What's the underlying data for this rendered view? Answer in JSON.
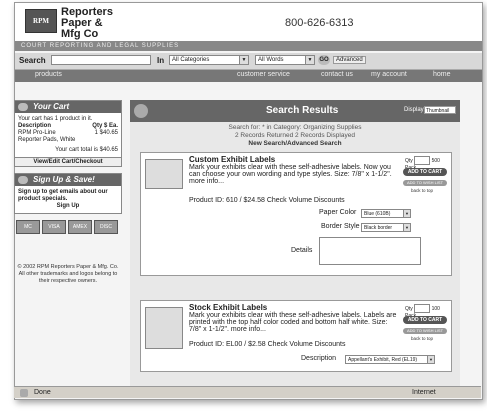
{
  "header": {
    "logo": "RPM",
    "brand_line1": "Reporters",
    "brand_line2": "Paper &",
    "brand_line3": "Mfg Co",
    "phone": "800-626-6313",
    "tagline": "COURT REPORTING AND LEGAL SUPPLIES"
  },
  "search": {
    "label": "Search",
    "in_label": "In",
    "category": "All Categories",
    "words": "All Words",
    "go": "GO",
    "advanced": "Advanced"
  },
  "nav": {
    "products": "products",
    "customer_service": "customer service",
    "contact_us": "contact us",
    "my_account": "my account",
    "home": "home"
  },
  "cart": {
    "title": "Your Cart",
    "summary": "Your cart has 1 product in it.",
    "col_desc": "Description",
    "col_qty": "Qty",
    "col_ea": "$ Ea.",
    "item": "RPM Pro-Line Reporter Pads, White",
    "item_qty": "1",
    "item_price": "$40.65",
    "total": "Your cart total is $40.65",
    "view_edit": "View/Edit Cart/Checkout"
  },
  "signup": {
    "title": "Sign Up & Save!",
    "text": "Sign up to get emails about our product specials.",
    "link": "Sign Up"
  },
  "cards": [
    "MC",
    "VISA",
    "AMEX",
    "DISC"
  ],
  "copyright": "© 2002 RPM Reporters Paper & Mfg. Co. All other trademarks and logos belong to their respective owners.",
  "results": {
    "title": "Search Results",
    "display_label": "Display:",
    "display_value": "Thumbnail",
    "line1": "Search for: * in Category: Organizing Supplies",
    "line2": "2 Records Returned 2 Records Displayed",
    "line3": "New Search/Advanced Search"
  },
  "products": [
    {
      "title": "Custom Exhibit Labels",
      "desc": "Mark your exhibits clear with these self-adhesive labels. Now you can choose your own wording and type styles. Size: 7/8\" x 1-1/2\". more info...",
      "pid": "Product ID: 610 / $24.58",
      "volume": "Check Volume Discounts",
      "qty_label": "Qty",
      "qty_unit": "500 Pack",
      "add_btn": "ADD TO CART",
      "wish_btn": "ADD TO WISH LIST",
      "back": "back to top",
      "opt1_label": "Paper Color",
      "opt1_value": "Blue (610B)",
      "opt2_label": "Border Style",
      "opt2_value": "Black border",
      "details_label": "Details"
    },
    {
      "title": "Stock Exhibit Labels",
      "desc": "Mark your exhibits clear with these self-adhesive labels. Labels are printed with the top half color coded and bottom half white. Size: 7/8\" x 1-1/2\". more info...",
      "pid": "Product ID: EL00 / $2.58",
      "volume": "Check Volume Discounts",
      "qty_label": "Qty",
      "qty_unit": "100 Pack",
      "add_btn": "ADD TO CART",
      "wish_btn": "ADD TO WISH LIST",
      "back": "back to top",
      "opt1_label": "Description",
      "opt1_value": "Appellant's Exhibit, Red (EL19)"
    }
  ],
  "status": {
    "done": "Done",
    "zone": "Internet"
  }
}
